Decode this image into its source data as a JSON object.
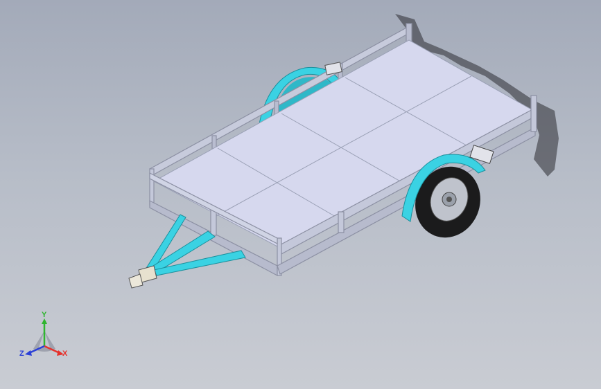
{
  "viewport": {
    "background_top": "#a3aab9",
    "background_bottom": "#c9ccd3"
  },
  "model": {
    "deck_color": "#d6d8ee",
    "frame_color": "#c4c8da",
    "accent_color": "#3ad2e3",
    "tire_color": "#1b1b1c",
    "wheel_color": "#bfc3cc"
  },
  "triad": {
    "x_label": "X",
    "y_label": "Y",
    "z_label": "Z",
    "x_color": "#e5322c",
    "y_color": "#2fb52f",
    "z_color": "#2a3fd7"
  }
}
